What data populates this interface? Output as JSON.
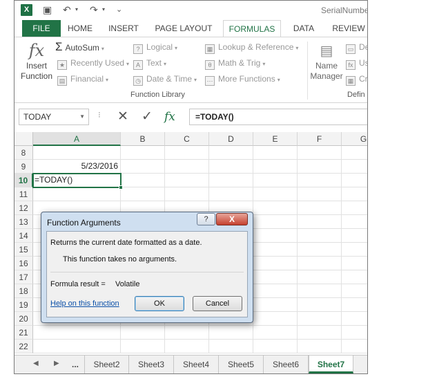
{
  "window": {
    "title": "SerialNumbe"
  },
  "ribbon": {
    "tabs": [
      {
        "label": "FILE"
      },
      {
        "label": "HOME"
      },
      {
        "label": "INSERT"
      },
      {
        "label": "PAGE LAYOUT"
      },
      {
        "label": "FORMULAS"
      },
      {
        "label": "DATA"
      },
      {
        "label": "REVIEW"
      }
    ],
    "active_tab": "FORMULAS",
    "insert_function": {
      "line1": "Insert",
      "line2": "Function",
      "glyph": "fx"
    },
    "library": {
      "col1": [
        {
          "label": "AutoSum"
        },
        {
          "label": "Recently Used"
        },
        {
          "label": "Financial"
        }
      ],
      "col2": [
        {
          "label": "Logical"
        },
        {
          "label": "Text"
        },
        {
          "label": "Date & Time"
        }
      ],
      "col3": [
        {
          "label": "Lookup & Reference"
        },
        {
          "label": "Math & Trig"
        },
        {
          "label": "More Functions"
        }
      ],
      "group_label": "Function Library"
    },
    "name_manager": {
      "line1": "Name",
      "line2": "Manager"
    },
    "defined_names": {
      "items": [
        "De",
        "Us",
        "Cr"
      ],
      "group_label": "Defin"
    }
  },
  "formula_bar": {
    "name_box": "TODAY",
    "cancel_glyph": "✕",
    "enter_glyph": "✓",
    "fx_glyph": "fx",
    "formula": "=TODAY()"
  },
  "grid": {
    "columns": [
      "A",
      "B",
      "C",
      "D",
      "E",
      "F",
      "G"
    ],
    "selected_column": "A",
    "rows": [
      "8",
      "9",
      "10",
      "11",
      "12",
      "13",
      "14",
      "15",
      "16",
      "17",
      "18",
      "19",
      "20",
      "21",
      "22"
    ],
    "selected_row": "10",
    "cells": {
      "A9": "5/23/2016",
      "A10": "=TODAY()"
    }
  },
  "sheet_tabs": {
    "ellipsis": "...",
    "tabs": [
      "Sheet2",
      "Sheet3",
      "Sheet4",
      "Sheet5",
      "Sheet6",
      "Sheet7"
    ],
    "active": "Sheet7"
  },
  "dialog": {
    "title": "Function Arguments",
    "help_glyph": "?",
    "close_glyph": "X",
    "description": "Returns the current date formatted as a date.",
    "no_args": "This function takes no arguments.",
    "result_label": "Formula result =",
    "result_value": "Volatile",
    "help_link": "Help on this function",
    "ok": "OK",
    "cancel": "Cancel"
  }
}
